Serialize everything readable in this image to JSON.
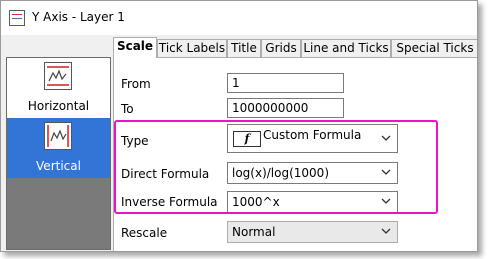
{
  "window": {
    "title": "Y Axis - Layer 1"
  },
  "sidebar": {
    "items": [
      {
        "label": "Horizontal",
        "icon": "horizontal-axis-icon",
        "selected": false
      },
      {
        "label": "Vertical",
        "icon": "vertical-axis-icon",
        "selected": true
      }
    ]
  },
  "tabs": [
    {
      "label": "Scale",
      "active": true
    },
    {
      "label": "Tick Labels",
      "active": false
    },
    {
      "label": "Title",
      "active": false
    },
    {
      "label": "Grids",
      "active": false
    },
    {
      "label": "Line and Ticks",
      "active": false
    },
    {
      "label": "Special Ticks",
      "active": false
    }
  ],
  "scale": {
    "from_label": "From",
    "from_value": "1",
    "to_label": "To",
    "to_value": "1000000000",
    "type_label": "Type",
    "type_icon_glyph": "f",
    "type_value": "Custom Formula",
    "direct_label": "Direct Formula",
    "direct_value": "log(x)/log(1000)",
    "inverse_label": "Inverse Formula",
    "inverse_value": "1000^x",
    "rescale_label": "Rescale",
    "rescale_value": "Normal"
  },
  "colors": {
    "highlight": "#e815c8",
    "selected_nav": "#3375d6"
  }
}
